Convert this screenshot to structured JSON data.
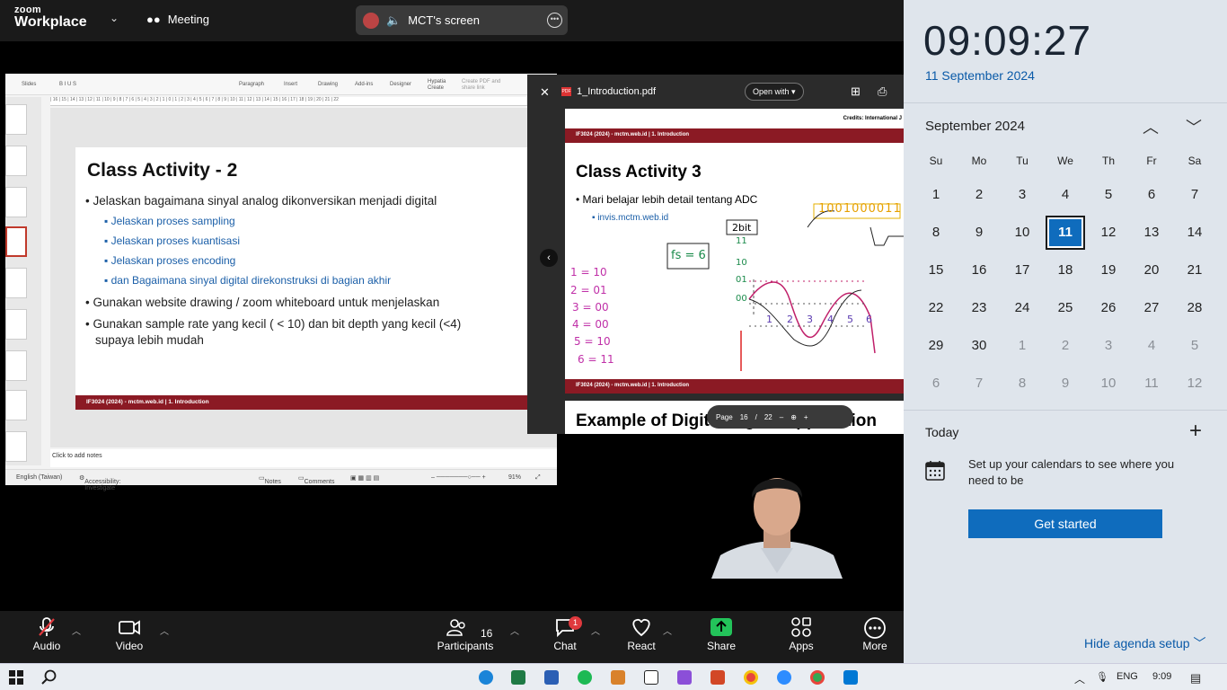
{
  "zoom": {
    "logo_line1": "zoom",
    "logo_line2": "Workplace",
    "meeting_label": "Meeting",
    "screen_label": "MCT's screen",
    "bottom": {
      "audio": "Audio",
      "video": "Video",
      "participants": "Participants",
      "participants_count": "16",
      "chat": "Chat",
      "chat_badge": "1",
      "react": "React",
      "share": "Share",
      "apps": "Apps",
      "more": "More"
    }
  },
  "ppt": {
    "ribbon": [
      "Slides",
      "Paragraph",
      "Insert",
      "Drawing",
      "Add-ins",
      "Designer",
      "Hypatia Create",
      "Create PDF and share link"
    ],
    "slide_title": "Class Activity - 2",
    "bullet1": "Jelaskan bagaimana sinyal analog dikonversikan menjadi digital",
    "sub1": "Jelaskan proses sampling",
    "sub2": "Jelaskan proses kuantisasi",
    "sub3": "Jelaskan proses encoding",
    "sub4": "dan Bagaimana sinyal digital direkonstruksi di bagian akhir",
    "bullet2": "Gunakan website drawing / zoom whiteboard untuk menjelaskan",
    "bullet3a": "Gunakan sample rate yang kecil ( < 10) dan bit depth yang kecil (<4)",
    "bullet3b": "supaya lebih mudah",
    "footer": "IF3024 (2024) - mctm.web.id | 1. Introduction",
    "notes": "Click to add notes",
    "status_lang": "English (Taiwan)",
    "status_access": "Accessibility: Investigate",
    "status_notes": "Notes",
    "status_comments": "Comments",
    "zoom_pct": "91%"
  },
  "pdf": {
    "filename": "1_Introduction.pdf",
    "open_with": "Open with",
    "credits": "Credits: International J",
    "top_footer": "IF3024 (2024) - mctm.web.id | 1. Introduction",
    "title": "Class Activity 3",
    "bullet": "Mari belajar lebih detail tentang ADC",
    "link": "invis.mctm.web.id",
    "bottom_footer": "IF3024 (2024) - mctm.web.id | 1. Introduction",
    "next_title": "Example of Digital Signal Application",
    "page_label": "Page",
    "page_num": "16",
    "page_sep": "/",
    "page_total": "22",
    "hand_bits": "2bit",
    "hand_fs": "fs = 6",
    "hand_binary": "1001000011",
    "hand_map": [
      "1 = 10",
      "2 = 01",
      "3 = 00",
      "4 = 00",
      "5 = 10",
      "6 = 11"
    ],
    "hand_y": [
      "11",
      "10",
      "01",
      "00"
    ],
    "hand_x": [
      "1",
      "2",
      "3",
      "4",
      "5",
      "6"
    ]
  },
  "taskbar": {
    "lang": "ENG",
    "time": "9:09"
  },
  "calendar": {
    "clock": "09:09:27",
    "date": "11 September 2024",
    "month": "September 2024",
    "weekdays": [
      "Su",
      "Mo",
      "Tu",
      "We",
      "Th",
      "Fr",
      "Sa"
    ],
    "days": [
      [
        "1",
        "2",
        "3",
        "4",
        "5",
        "6",
        "7"
      ],
      [
        "8",
        "9",
        "10",
        "11",
        "12",
        "13",
        "14"
      ],
      [
        "15",
        "16",
        "17",
        "18",
        "19",
        "20",
        "21"
      ],
      [
        "22",
        "23",
        "24",
        "25",
        "26",
        "27",
        "28"
      ],
      [
        "29",
        "30",
        "1",
        "2",
        "3",
        "4",
        "5"
      ],
      [
        "6",
        "7",
        "8",
        "9",
        "10",
        "11",
        "12"
      ]
    ],
    "today": "Today",
    "setup_text": "Set up your calendars to see where you need to be",
    "get_started": "Get started",
    "hide_agenda": "Hide agenda setup"
  },
  "colors": {
    "accent": "#0f6cbd",
    "slide_footer": "#8b1a24",
    "share_green": "#23c35a",
    "sub_bullet": "#1b5fa8"
  }
}
